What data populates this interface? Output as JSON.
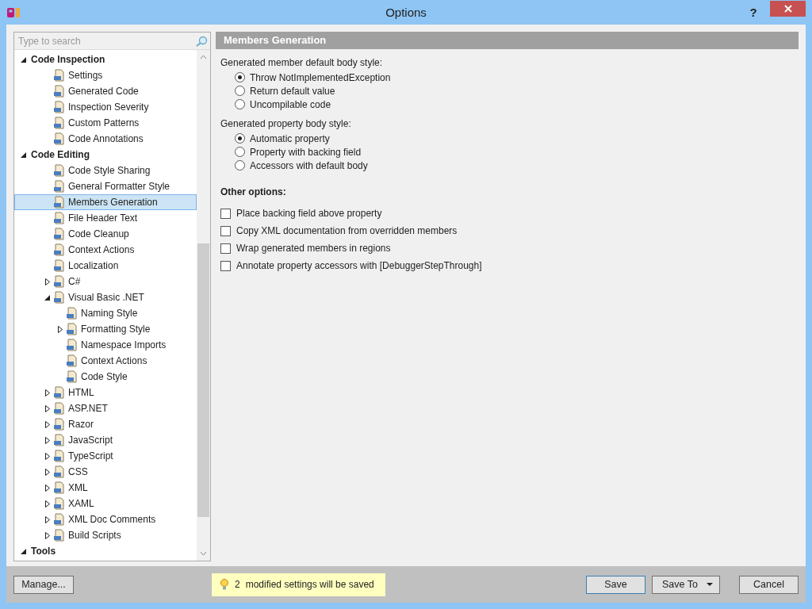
{
  "window": {
    "title": "Options",
    "help": "?"
  },
  "search": {
    "placeholder": "Type to search"
  },
  "tree": {
    "items": [
      {
        "label": "Code Inspection",
        "expanded": true,
        "selected": false,
        "children": [
          {
            "label": "Settings",
            "selected": false
          },
          {
            "label": "Generated Code",
            "selected": false
          },
          {
            "label": "Inspection Severity",
            "selected": false
          },
          {
            "label": "Custom Patterns",
            "selected": false
          },
          {
            "label": "Code Annotations",
            "selected": false
          }
        ]
      },
      {
        "label": "Code Editing",
        "expanded": true,
        "selected": false,
        "children": [
          {
            "label": "Code Style Sharing",
            "selected": false
          },
          {
            "label": "General Formatter Style",
            "selected": false
          },
          {
            "label": "Members Generation",
            "selected": true
          },
          {
            "label": "File Header Text",
            "selected": false
          },
          {
            "label": "Code Cleanup",
            "selected": false
          },
          {
            "label": "Context Actions",
            "selected": false
          },
          {
            "label": "Localization",
            "selected": false
          },
          {
            "label": "C#",
            "expanded": false,
            "selected": false
          },
          {
            "label": "Visual Basic .NET",
            "expanded": true,
            "selected": false,
            "children": [
              {
                "label": "Naming Style",
                "selected": false
              },
              {
                "label": "Formatting Style",
                "expanded": false,
                "selected": false
              },
              {
                "label": "Namespace Imports",
                "selected": false
              },
              {
                "label": "Context Actions",
                "selected": false
              },
              {
                "label": "Code Style",
                "selected": false
              }
            ]
          },
          {
            "label": "HTML",
            "expanded": false,
            "selected": false
          },
          {
            "label": "ASP.NET",
            "expanded": false,
            "selected": false
          },
          {
            "label": "Razor",
            "expanded": false,
            "selected": false
          },
          {
            "label": "JavaScript",
            "expanded": false,
            "selected": false
          },
          {
            "label": "TypeScript",
            "expanded": false,
            "selected": false
          },
          {
            "label": "CSS",
            "expanded": false,
            "selected": false
          },
          {
            "label": "XML",
            "expanded": false,
            "selected": false
          },
          {
            "label": "XAML",
            "expanded": false,
            "selected": false
          },
          {
            "label": "XML Doc Comments",
            "expanded": false,
            "selected": false
          },
          {
            "label": "Build Scripts",
            "expanded": false,
            "selected": false
          }
        ]
      },
      {
        "label": "Tools",
        "expanded": true,
        "selected": false
      }
    ]
  },
  "panel": {
    "title": "Members Generation",
    "radio_groups": [
      {
        "label": "Generated member default body style:",
        "options": [
          {
            "label": "Throw NotImplementedException",
            "selected": true
          },
          {
            "label": "Return default value",
            "selected": false
          },
          {
            "label": "Uncompilable code",
            "selected": false
          }
        ]
      },
      {
        "label": "Generated property body style:",
        "options": [
          {
            "label": "Automatic property",
            "selected": true
          },
          {
            "label": "Property with backing field",
            "selected": false
          },
          {
            "label": "Accessors with default body",
            "selected": false
          }
        ]
      }
    ],
    "other_heading": "Other options:",
    "checkboxes": [
      {
        "label": "Place backing field above property",
        "checked": false
      },
      {
        "label": "Copy XML documentation from overridden members",
        "checked": false
      },
      {
        "label": "Wrap generated members in regions",
        "checked": false
      },
      {
        "label": "Annotate property accessors with [DebuggerStepThrough]",
        "checked": false
      }
    ]
  },
  "footer": {
    "manage": "Manage...",
    "notice_count": "2",
    "notice": "modified settings will be saved",
    "save": "Save",
    "save_to": "Save To",
    "cancel": "Cancel"
  }
}
